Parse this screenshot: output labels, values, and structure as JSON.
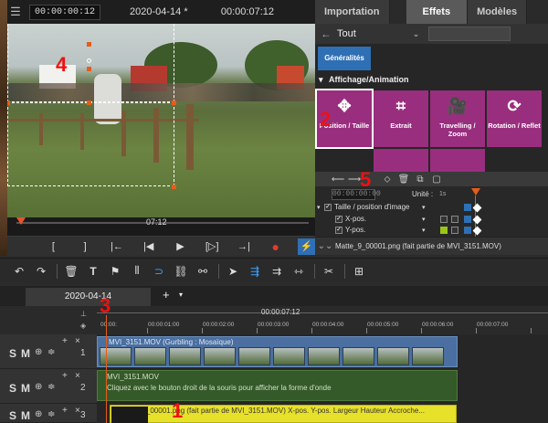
{
  "preview": {
    "menu_icon": "hamburger-icon",
    "timecode_left": "00:00:00:12",
    "date_title": "2020-04-14 *",
    "timecode_right": "00:00:07:12",
    "scrub_time": "07:12"
  },
  "transport": {
    "buttons": [
      "[",
      "]",
      "|←",
      "|◀",
      "▶",
      "[▷]",
      "→|",
      "●",
      "⚡"
    ]
  },
  "right_panel": {
    "tabs": [
      {
        "label": "Importation",
        "active": false
      },
      {
        "label": "Effets",
        "active": true
      },
      {
        "label": "Modèles",
        "active": false
      }
    ],
    "filter_label": "Tout",
    "general_button": "Généralités",
    "category": "Affichage/Animation",
    "tiles": [
      {
        "label": "Position / Taille",
        "icon": "✥",
        "selected": true
      },
      {
        "label": "Extrait",
        "icon": "⌗",
        "selected": false
      },
      {
        "label": "Travelling / Zoom",
        "icon": "🎥",
        "selected": false
      },
      {
        "label": "Rotation / Reflet",
        "icon": "⟳",
        "selected": false
      }
    ],
    "keyframes": {
      "timecode": "00:00:00:00",
      "unit_label": "Unité :",
      "unit_value": "1s",
      "group_label": "Taille / position d'image",
      "rows": [
        "X-pos.",
        "Y-pos."
      ]
    },
    "status_text": "Matte_9_00001.png (fait partie de MVI_3151.MOV)"
  },
  "timeline": {
    "tab_label": "2020-04-14",
    "ruler_center": "00:00:07:12",
    "ruler_labels": [
      "00:00:",
      "00:00:01:00",
      "00:00:02:00",
      "00:00:03:00",
      "00:00:04:00",
      "00:00:05:00",
      "00:00:06:00",
      "00:00:07:00"
    ],
    "tracks": [
      {
        "number": "1",
        "clip_label": "MVI_3151.MOV  (Gurbling : Mosaïque)"
      },
      {
        "number": "2",
        "clip_label": "MVI_3151.MOV",
        "clip_sub": "Cliquez avec le bouton droit de la souris pour afficher la forme d'onde"
      },
      {
        "number": "3",
        "clip_label": "Matte_9_00001.png (fait partie de MVI_3151.MOV)  X-pos.  Y-pos.  Largeur  Hauteur  Accroche..."
      }
    ],
    "track_letters": {
      "solo": "S",
      "mute": "M"
    }
  },
  "annotations": [
    "1",
    "2",
    "3",
    "4",
    "5"
  ],
  "colors": {
    "accent_blue": "#2f6fb4",
    "effect_tile": "#9a2e7e",
    "playhead": "#e65c1a",
    "track1_clip": "#4a6fa0",
    "track2_clip": "#355a2a",
    "track3_clip": "#e8e12a",
    "annotation_red": "#e11111"
  }
}
